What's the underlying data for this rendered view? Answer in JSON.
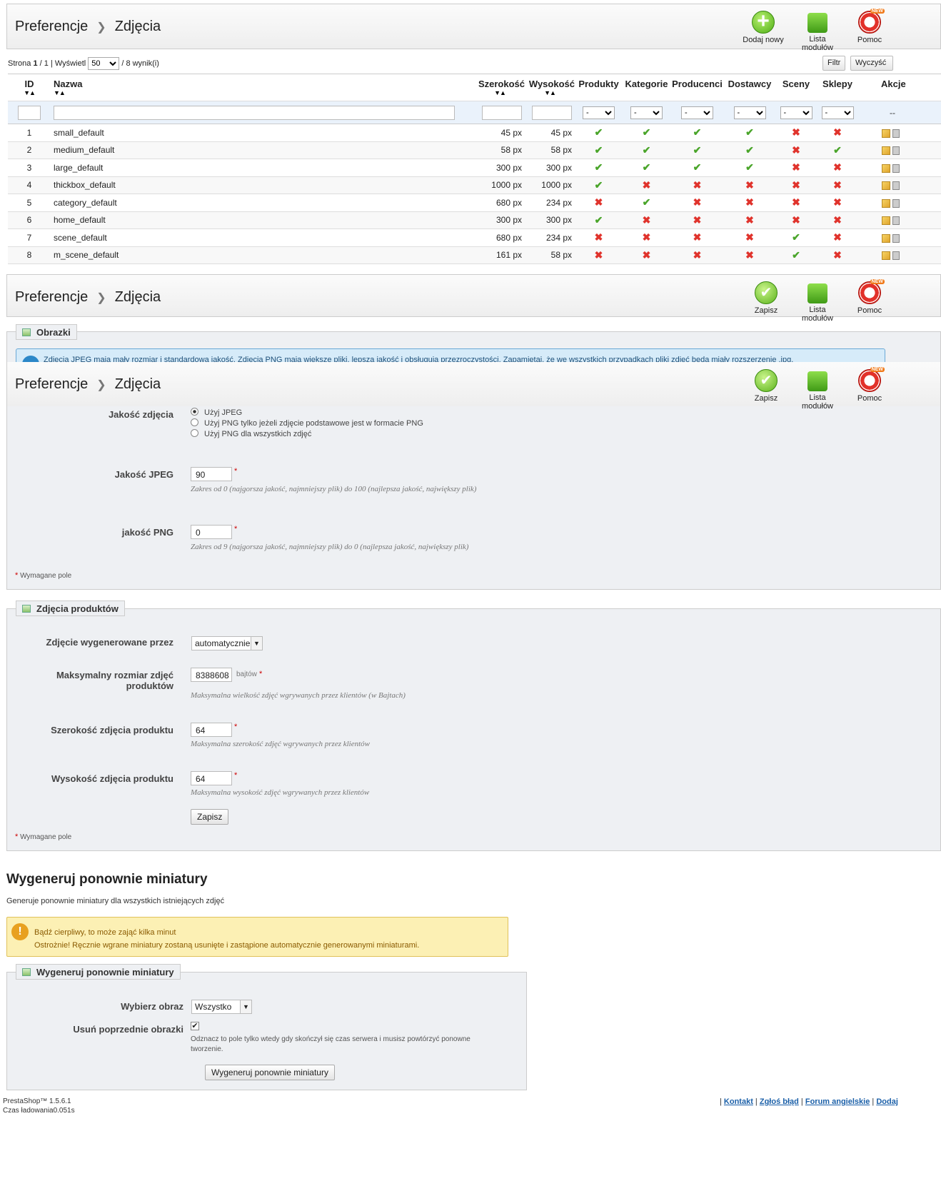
{
  "toolbar1": {
    "crumb1": "Preferencje",
    "crumb2": "Zdjęcia",
    "btn_add": "Dodaj nowy",
    "btn_modules": "Lista modułów",
    "btn_help": "Pomoc"
  },
  "pagination": {
    "strona": "Strona",
    "current": "1",
    "sep": "/",
    "total": "1",
    "wyswietl": "| Wyświetl",
    "per_page": "50",
    "results": "/ 8 wynik(i)"
  },
  "filter_btn": "Filtr",
  "clear_btn": "Wyczyść",
  "columns": [
    "ID",
    "Nazwa",
    "Szerokość",
    "Wysokość",
    "Produkty",
    "Kategorie",
    "Producenci",
    "Dostawcy",
    "Sceny",
    "Sklepy",
    "Akcje"
  ],
  "filter_select": "-",
  "filter_dash": "--",
  "rows": [
    {
      "id": "1",
      "name": "small_default",
      "w": "45 px",
      "h": "45 px",
      "p": "yes",
      "k": "yes",
      "pr": "yes",
      "d": "yes",
      "s": "no",
      "sk": "no"
    },
    {
      "id": "2",
      "name": "medium_default",
      "w": "58 px",
      "h": "58 px",
      "p": "yes",
      "k": "yes",
      "pr": "yes",
      "d": "yes",
      "s": "no",
      "sk": "yes"
    },
    {
      "id": "3",
      "name": "large_default",
      "w": "300 px",
      "h": "300 px",
      "p": "yes",
      "k": "yes",
      "pr": "yes",
      "d": "yes",
      "s": "no",
      "sk": "no"
    },
    {
      "id": "4",
      "name": "thickbox_default",
      "w": "1000 px",
      "h": "1000 px",
      "p": "yes",
      "k": "no",
      "pr": "no",
      "d": "no",
      "s": "no",
      "sk": "no"
    },
    {
      "id": "5",
      "name": "category_default",
      "w": "680 px",
      "h": "234 px",
      "p": "no",
      "k": "yes",
      "pr": "no",
      "d": "no",
      "s": "no",
      "sk": "no"
    },
    {
      "id": "6",
      "name": "home_default",
      "w": "300 px",
      "h": "300 px",
      "p": "yes",
      "k": "no",
      "pr": "no",
      "d": "no",
      "s": "no",
      "sk": "no"
    },
    {
      "id": "7",
      "name": "scene_default",
      "w": "680 px",
      "h": "234 px",
      "p": "no",
      "k": "no",
      "pr": "no",
      "d": "no",
      "s": "yes",
      "sk": "no"
    },
    {
      "id": "8",
      "name": "m_scene_default",
      "w": "161 px",
      "h": "58 px",
      "p": "no",
      "k": "no",
      "pr": "no",
      "d": "no",
      "s": "yes",
      "sk": "no"
    }
  ],
  "toolbar2": {
    "crumb1": "Preferencje",
    "crumb2": "Zdjęcia",
    "btn_save": "Zapisz",
    "btn_modules": "Lista modułów",
    "btn_help": "Pomoc"
  },
  "obrazki_legend": "Obrazki",
  "info_text": "Zdjęcia JPEG mają mały rozmiar i standardową jakość. Zdjęcia PNG mają większe pliki, lepszą jakość i obsługują przezroczystości. Zapamiętaj, że we wszystkich przypadkach pliki zdjęć będą miały rozszerzenie .jpg.",
  "quality": {
    "label": "Jakość zdjęcia",
    "opt1": "Użyj JPEG",
    "opt2": "Użyj PNG tylko jeżeli zdjęcie podstawowe jest w formacie PNG",
    "opt3": "Użyj PNG dla wszystkich zdjęć"
  },
  "jpeg": {
    "label": "Jakość JPEG",
    "value": "90",
    "hint": "Zakres od 0 (najgorsza jakość, najmniejszy plik) do 100 (najlepsza jakość, największy plik)"
  },
  "png": {
    "label": "jakość PNG",
    "value": "0",
    "hint": "Zakres od 9 (najgorsza jakość, najmniejszy plik) do 0 (najlepsza jakość, największy plik)"
  },
  "required_note": "Wymagane pole",
  "products_legend": "Zdjęcia produktów",
  "gen_by": {
    "label": "Zdjęcie wygenerowane przez",
    "value": "automatycznie"
  },
  "max_size": {
    "label": "Maksymalny rozmiar zdjęć produktów",
    "value": "8388608",
    "unit": "bajtów",
    "hint": "Maksymalna wielkość zdjęć wgrywanych przez klientów (w Bajtach)"
  },
  "prod_width": {
    "label": "Szerokość zdjęcia produktu",
    "value": "64",
    "hint": "Maksymalna szerokość zdjęć wgrywanych przez klientów"
  },
  "prod_height": {
    "label": "Wysokość zdjęcia produktu",
    "value": "64",
    "hint": "Maksymalna wysokość zdjęć wgrywanych przez klientów"
  },
  "save_btn": "Zapisz",
  "regen": {
    "title": "Wygeneruj ponownie miniatury",
    "desc": "Generuje ponownie miniatury dla wszystkich istniejących zdjęć",
    "warn1": "Bądź cierpliwy, to może zająć kilka minut",
    "warn2": "Ostrożnie! Ręcznie wgrane miniatury zostaną usunięte i zastąpione automatycznie generowanymi miniaturami.",
    "legend": "Wygeneruj ponownie miniatury",
    "choose_label": "Wybierz obraz",
    "choose_value": "Wszystko",
    "delete_label": "Usuń poprzednie obrazki",
    "delete_hint": "Odznacz to pole tylko wtedy gdy skończył się czas serwera i musisz powtórzyć ponowne tworzenie.",
    "button": "Wygeneruj ponownie miniatury"
  },
  "footer": {
    "version": "PrestaShop™ 1.5.6.1",
    "load": "Czas ładowania0.051s",
    "links": [
      "Kontakt",
      "Zgłoś błąd",
      "Forum angielskie",
      "Dodaj"
    ]
  },
  "colors": {
    "yes": "#4aa52a",
    "no": "#e0332c",
    "info": "#d6ebf9",
    "warn": "#fcf0b4"
  }
}
